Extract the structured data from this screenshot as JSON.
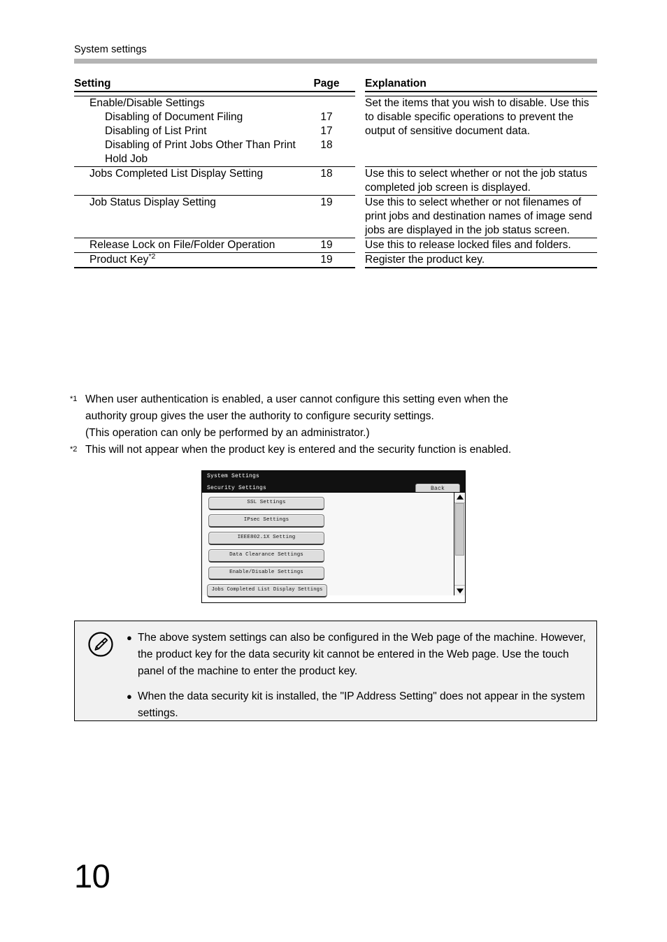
{
  "header": {
    "running_title": "System settings"
  },
  "table": {
    "columns": {
      "setting": "Setting",
      "page": "Page",
      "explanation": "Explanation"
    },
    "groups": [
      {
        "rows": [
          {
            "indent": 1,
            "setting": "Enable/Disable Settings",
            "page": ""
          },
          {
            "indent": 2,
            "setting": "Disabling of Document Filing",
            "page": "17"
          },
          {
            "indent": 2,
            "setting": "Disabling of List Print",
            "page": "17"
          },
          {
            "indent": 2,
            "setting": "Disabling of Print Jobs Other Than Print Hold Job",
            "page": "18"
          }
        ],
        "explanation": "Set the items that you wish to disable. Use this to disable specific operations to prevent the output of sensitive document data."
      },
      {
        "rows": [
          {
            "indent": 1,
            "setting": "Jobs Completed List Display Setting",
            "page": "18"
          }
        ],
        "explanation": "Use this to select whether or not the job status completed job screen is displayed."
      },
      {
        "rows": [
          {
            "indent": 1,
            "setting": "Job Status Display Setting",
            "page": "19"
          }
        ],
        "explanation": "Use this to select whether or not filenames of print jobs and destination names of image send jobs are displayed in the job status screen."
      },
      {
        "rows": [
          {
            "indent": 1,
            "setting": "Release Lock on File/Folder Operation",
            "page": "19"
          }
        ],
        "explanation": "Use this to release locked files and folders."
      },
      {
        "rows": [
          {
            "indent": 1,
            "setting": "Product Key",
            "footnote": "*2",
            "page": "19"
          }
        ],
        "explanation": "Register the product key."
      }
    ]
  },
  "footnotes": [
    {
      "mark": "*1",
      "lines": [
        "When user authentication is enabled, a user cannot configure this setting even when the",
        "authority group gives the user the authority to configure security settings.",
        "(This operation can only be performed by an administrator.)"
      ]
    },
    {
      "mark": "*2",
      "lines": [
        "This will not appear when the product key is entered and the security function is enabled."
      ]
    }
  ],
  "panel": {
    "title": "System Settings",
    "subtitle": "Security Settings",
    "back_label": "Back",
    "buttons": [
      {
        "label": "SSL Settings",
        "wide": false
      },
      {
        "label": "IPsec Settings",
        "wide": false
      },
      {
        "label": "IEEE802.1X Setting",
        "wide": false
      },
      {
        "label": "Data Clearance Settings",
        "wide": false
      },
      {
        "label": "Enable/Disable Settings",
        "wide": false
      },
      {
        "label": "Jobs Completed List Display Settings",
        "wide": true
      }
    ],
    "scrollbar": {
      "up_arrow": "scroll-up-arrow",
      "down_arrow": "scroll-down-arrow"
    }
  },
  "note": {
    "icon": "pencil-note-icon",
    "bullet": "●",
    "items": [
      "The above system settings can also be configured in the Web page of the machine. However, the product key for the data security kit cannot be entered in the Web page. Use the touch panel of the machine to enter the product key.",
      "When the data security kit is installed, the \"IP Address Setting\" does not appear in the system settings."
    ]
  },
  "page_number": "10",
  "colors": {
    "header_rule": "#b4b4b4",
    "note_background": "#f1f1f1",
    "panel_bar": "#111111",
    "panel_body": "#f7f7f7"
  }
}
